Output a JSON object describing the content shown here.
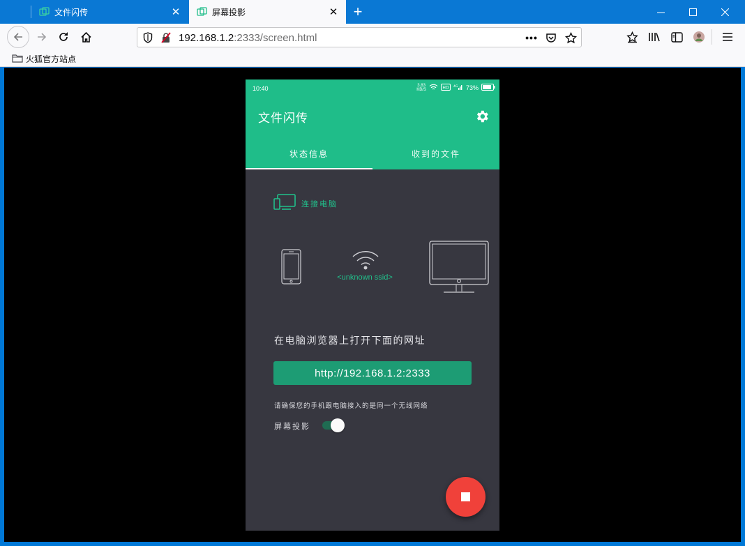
{
  "browser": {
    "tabs": [
      {
        "title": "文件闪传",
        "active": false
      },
      {
        "title": "屏幕投影",
        "active": true
      }
    ],
    "new_tab_icon": "plus-icon",
    "url": {
      "host": "192.168.1.2",
      "rest": ":2333/screen.html"
    },
    "bookmarks": [
      {
        "label": "火狐官方站点",
        "icon": "folder-icon"
      }
    ]
  },
  "phone": {
    "status": {
      "time": "10:40",
      "speed": "3.83",
      "speed_unit": "KB/S",
      "battery": "73%"
    },
    "app_title": "文件闪传",
    "tabs": [
      "状态信息",
      "收到的文件"
    ],
    "connect_label": "连接电脑",
    "ssid": "<unknown ssid>",
    "open_instruction": "在电脑浏览器上打开下面的网址",
    "address": "http://192.168.1.2:2333",
    "hint": "请确保您的手机跟电脑接入的是同一个无线网络",
    "projection_label": "屏幕投影",
    "projection_on": true
  },
  "colors": {
    "titlebar": "#0a78d4",
    "accent_green": "#1fbd89",
    "phone_bg": "#373740",
    "fab_red": "#f0413a"
  }
}
